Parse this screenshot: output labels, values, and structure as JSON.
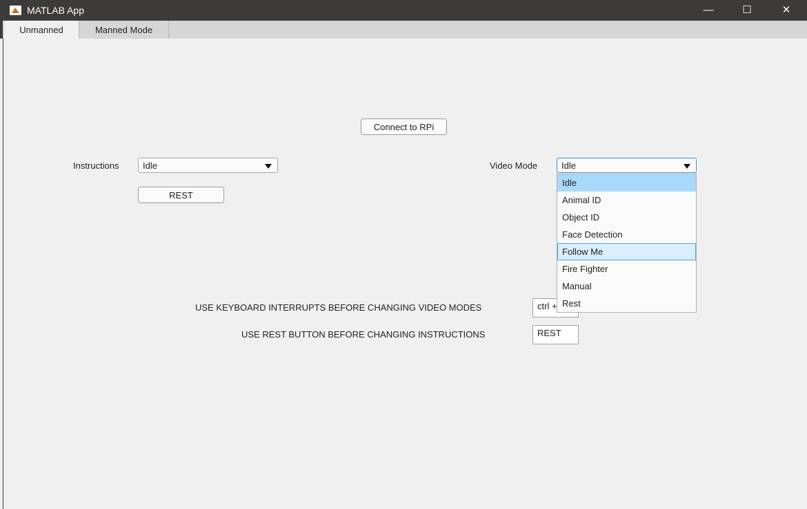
{
  "window": {
    "title": "MATLAB App",
    "minimize": "—",
    "maximize": "☐",
    "close": "✕"
  },
  "tabs": [
    {
      "label": "Unmanned"
    },
    {
      "label": "Manned Mode"
    }
  ],
  "connect_button": "Connect to RPi",
  "instructions": {
    "label": "Instructions",
    "value": "Idle",
    "rest_button": "REST"
  },
  "video_mode": {
    "label": "Video Mode",
    "value": "Idle",
    "options": [
      "Idle",
      "Animal ID",
      "Object ID",
      "Face Detection",
      "Follow Me",
      "Fire Fighter",
      "Manual",
      "Rest"
    ],
    "selected": "Idle",
    "hovered": "Follow Me"
  },
  "notes": [
    {
      "text": "USE KEYBOARD INTERRUPTS BEFORE CHANGING VIDEO MODES",
      "value": "ctrl +"
    },
    {
      "text": "USE REST BUTTON BEFORE CHANGING INSTRUCTIONS",
      "value": "REST"
    }
  ]
}
